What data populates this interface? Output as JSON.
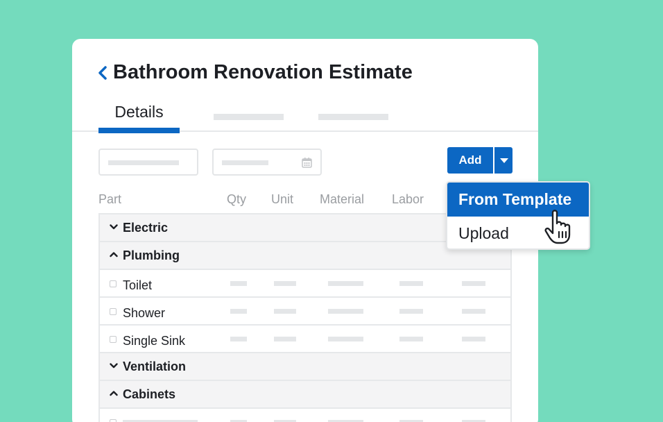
{
  "header": {
    "title": "Bathroom Renovation Estimate",
    "back_icon": "chevron-left-icon"
  },
  "tabs": [
    {
      "label": "Details",
      "active": true
    }
  ],
  "toolbar": {
    "add_label": "Add",
    "calendar_icon": "calendar-icon"
  },
  "dropdown": {
    "items": [
      {
        "label": "From Template",
        "highlighted": true
      },
      {
        "label": "Upload",
        "highlighted": false
      }
    ]
  },
  "table": {
    "columns": [
      "Part",
      "Qty",
      "Unit",
      "Material",
      "Labor"
    ],
    "rows": [
      {
        "type": "group",
        "label": "Electric",
        "expanded": false
      },
      {
        "type": "group",
        "label": "Plumbing",
        "expanded": true
      },
      {
        "type": "item",
        "label": "Toilet"
      },
      {
        "type": "item",
        "label": "Shower"
      },
      {
        "type": "item",
        "label": "Single Sink"
      },
      {
        "type": "group",
        "label": "Ventilation",
        "expanded": false
      },
      {
        "type": "group",
        "label": "Cabinets",
        "expanded": true
      }
    ]
  },
  "colors": {
    "background": "#74dbbd",
    "accent": "#0c67c3",
    "placeholder": "#e4e6e8"
  }
}
